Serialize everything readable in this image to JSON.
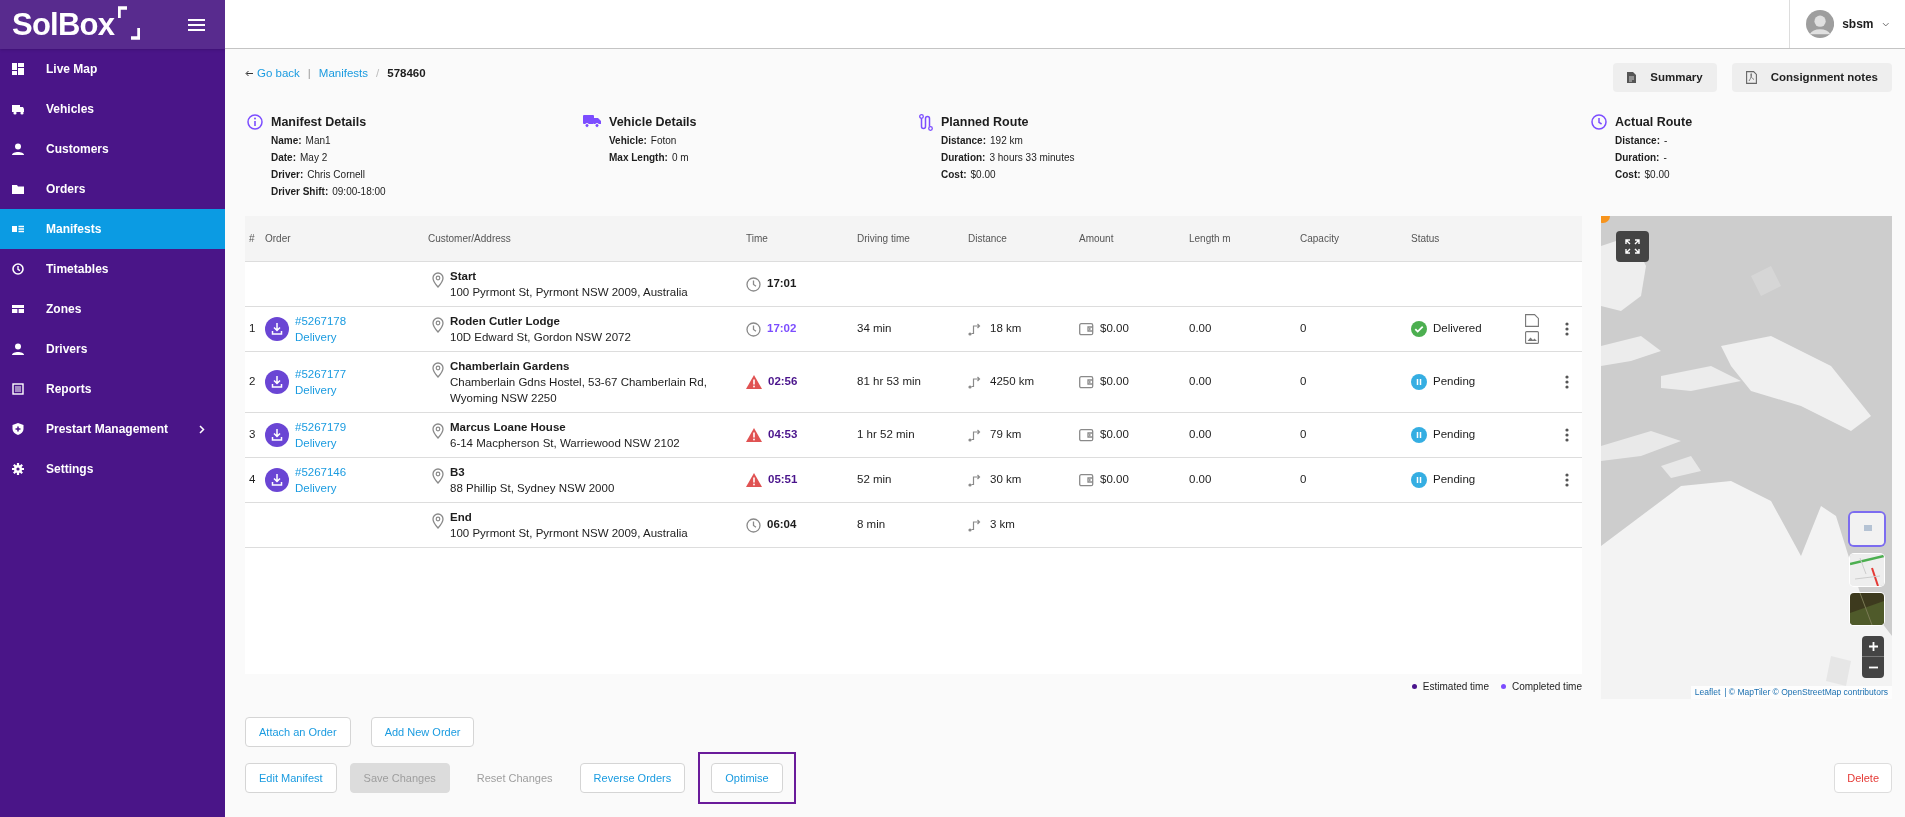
{
  "sidebar": {
    "logo": "SolBox",
    "items": [
      {
        "label": "Live Map",
        "selected": false,
        "has_submenu": false
      },
      {
        "label": "Vehicles",
        "selected": false,
        "has_submenu": false
      },
      {
        "label": "Customers",
        "selected": false,
        "has_submenu": false
      },
      {
        "label": "Orders",
        "selected": false,
        "has_submenu": false
      },
      {
        "label": "Manifests",
        "selected": true,
        "has_submenu": false
      },
      {
        "label": "Timetables",
        "selected": false,
        "has_submenu": false
      },
      {
        "label": "Zones",
        "selected": false,
        "has_submenu": false
      },
      {
        "label": "Drivers",
        "selected": false,
        "has_submenu": false
      },
      {
        "label": "Reports",
        "selected": false,
        "has_submenu": false
      },
      {
        "label": "Prestart Management",
        "selected": false,
        "has_submenu": true
      },
      {
        "label": "Settings",
        "selected": false,
        "has_submenu": false
      }
    ]
  },
  "header": {
    "user": "sbsm"
  },
  "breadcrumb": {
    "back": "Go back",
    "links": [
      {
        "separator": "|",
        "label": "Manifests"
      }
    ],
    "current_separator": "/",
    "current": "578460"
  },
  "actions": [
    "Summary",
    "Consignment notes"
  ],
  "details": [
    {
      "title": "Manifest Details",
      "fields": [
        {
          "label": "Name:",
          "value": "Man1"
        },
        {
          "label": "Date:",
          "value": "May 2"
        },
        {
          "label": "Driver:",
          "value": "Chris Cornell"
        },
        {
          "label": "Driver Shift:",
          "value": "09:00-18:00"
        }
      ]
    },
    {
      "title": "Vehicle Details",
      "fields": [
        {
          "label": "Vehicle:",
          "value": "Foton"
        },
        {
          "label": "Max Length:",
          "value": "0 m"
        }
      ]
    },
    {
      "title": "Planned Route",
      "fields": [
        {
          "label": "Distance:",
          "value": "192 km"
        },
        {
          "label": "Duration:",
          "value": "3 hours 33 minutes"
        },
        {
          "label": "Cost:",
          "value": "$0.00"
        }
      ]
    },
    {
      "title": "Actual Route",
      "fields": [
        {
          "label": "Distance:",
          "value": "-"
        },
        {
          "label": "Duration:",
          "value": "-"
        },
        {
          "label": "Cost:",
          "value": "$0.00"
        }
      ]
    }
  ],
  "table": {
    "columns": [
      "#",
      "Order",
      "Customer/Address",
      "Time",
      "Driving time",
      "Distance",
      "Amount",
      "Length m",
      "Capacity",
      "Status"
    ],
    "rows": [
      {
        "kind": "depot",
        "name": "Start",
        "address": "100 Pyrmont St, Pyrmont NSW 2009, Australia",
        "time": {
          "value": "17:01",
          "kind": "plain",
          "late": false
        }
      },
      {
        "kind": "stop",
        "number": "1",
        "order": "#5267178",
        "order_type": "Delivery",
        "name": "Roden Cutler Lodge",
        "address": "10D Edward St, Gordon NSW 2072",
        "time": {
          "value": "17:02",
          "kind": "completed",
          "late": false
        },
        "driving_time": "34 min",
        "distance": "18 km",
        "amount": "$0.00",
        "length": "0.00",
        "capacity": "0",
        "status": {
          "label": "Delivered",
          "kind": "delivered"
        },
        "attachments": true
      },
      {
        "kind": "stop",
        "number": "2",
        "order": "#5267177",
        "order_type": "Delivery",
        "name": "Chamberlain Gardens",
        "address": "Chamberlain Gdns Hostel, 53-67 Chamberlain Rd, Wyoming NSW 2250",
        "time": {
          "value": "02:56",
          "kind": "estimated",
          "late": true
        },
        "driving_time": "81 hr 53 min",
        "distance": "4250 km",
        "amount": "$0.00",
        "length": "0.00",
        "capacity": "0",
        "status": {
          "label": "Pending",
          "kind": "pending"
        },
        "attachments": false
      },
      {
        "kind": "stop",
        "number": "3",
        "order": "#5267179",
        "order_type": "Delivery",
        "name": "Marcus Loane House",
        "address": "6-14 Macpherson St, Warriewood NSW 2102",
        "time": {
          "value": "04:53",
          "kind": "estimated",
          "late": true
        },
        "driving_time": "1 hr 52 min",
        "distance": "79 km",
        "amount": "$0.00",
        "length": "0.00",
        "capacity": "0",
        "status": {
          "label": "Pending",
          "kind": "pending"
        },
        "attachments": false
      },
      {
        "kind": "stop",
        "number": "4",
        "order": "#5267146",
        "order_type": "Delivery",
        "name": "B3",
        "address": "88 Phillip St, Sydney NSW 2000",
        "time": {
          "value": "05:51",
          "kind": "estimated",
          "late": true
        },
        "driving_time": "52 min",
        "distance": "30 km",
        "amount": "$0.00",
        "length": "0.00",
        "capacity": "0",
        "status": {
          "label": "Pending",
          "kind": "pending"
        },
        "attachments": false
      },
      {
        "kind": "depot",
        "name": "End",
        "address": "100 Pyrmont St, Pyrmont NSW 2009, Australia",
        "time": {
          "value": "06:04",
          "kind": "plain",
          "late": false
        },
        "driving_time": "8 min",
        "distance": "3 km"
      }
    ]
  },
  "legend": [
    {
      "label": "Estimated time",
      "color": "#4a148c"
    },
    {
      "label": "Completed time",
      "color": "#7c4dff"
    }
  ],
  "map": {
    "layers": [
      {
        "selected": true
      },
      {
        "selected": false
      },
      {
        "selected": false
      }
    ],
    "attribution_link": "Leaflet",
    "attribution": "| © MapTiler © OpenStreetMap contributors"
  },
  "buttons": [
    [
      {
        "label": "Attach an Order",
        "kind": "outline",
        "disabled": false,
        "highlighted": false
      },
      {
        "label": "Add New Order",
        "kind": "outline",
        "disabled": false,
        "highlighted": false
      }
    ],
    [
      {
        "label": "Edit Manifest",
        "kind": "outline",
        "disabled": false,
        "highlighted": false
      },
      {
        "label": "Save Changes",
        "kind": "filled",
        "disabled": true,
        "highlighted": false
      },
      {
        "label": "Reset Changes",
        "kind": "text",
        "disabled": true,
        "highlighted": false
      },
      {
        "label": "Reverse Orders",
        "kind": "outline",
        "disabled": false,
        "highlighted": false
      },
      {
        "label": "Optimise",
        "kind": "outline",
        "disabled": false,
        "highlighted": true
      }
    ]
  ],
  "delete": {
    "label": "Delete"
  }
}
